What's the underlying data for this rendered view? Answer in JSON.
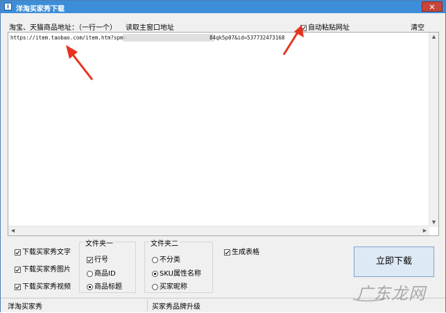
{
  "window": {
    "title": "洋淘买家秀下载",
    "close_glyph": "✕"
  },
  "toolbar": {
    "address_label": "淘宝、天猫商品地址：（一行一个）",
    "read_window_link": "读取主窗口地址",
    "auto_paste_label": "自动粘贴网址",
    "auto_paste_checked": true,
    "clear_link": "清空"
  },
  "editor": {
    "url_prefix": "https://item.taobao.com/item.htm?spm=",
    "url_suffix": "84qk5p07&id=537732473168"
  },
  "downloads": {
    "items": [
      {
        "label": "下载买家秀文字",
        "checked": true
      },
      {
        "label": "下载买家秀图片",
        "checked": true
      },
      {
        "label": "下载买家秀视频",
        "checked": true
      }
    ]
  },
  "folder1": {
    "title": "文件夹一",
    "options": [
      {
        "label": "行号",
        "type": "checkbox",
        "checked": true
      },
      {
        "label": "商品ID",
        "type": "radio",
        "checked": false
      },
      {
        "label": "商品标题",
        "type": "radio",
        "checked": true
      }
    ]
  },
  "folder2": {
    "title": "文件夹二",
    "options": [
      {
        "label": "不分类",
        "checked": false
      },
      {
        "label": "SKU属性名称",
        "checked": true
      },
      {
        "label": "买家昵称",
        "checked": false
      }
    ]
  },
  "generate_table": {
    "label": "生成表格",
    "checked": true
  },
  "download_button": {
    "label": "立即下载"
  },
  "status": {
    "left": "洋淘买家秀",
    "right": "买家秀品牌升级"
  },
  "watermark": {
    "text": "广东龙网"
  },
  "colors": {
    "titlebar": "#3c8ed8",
    "arrow": "#e8321f",
    "button_bg": "#dde9f5"
  }
}
